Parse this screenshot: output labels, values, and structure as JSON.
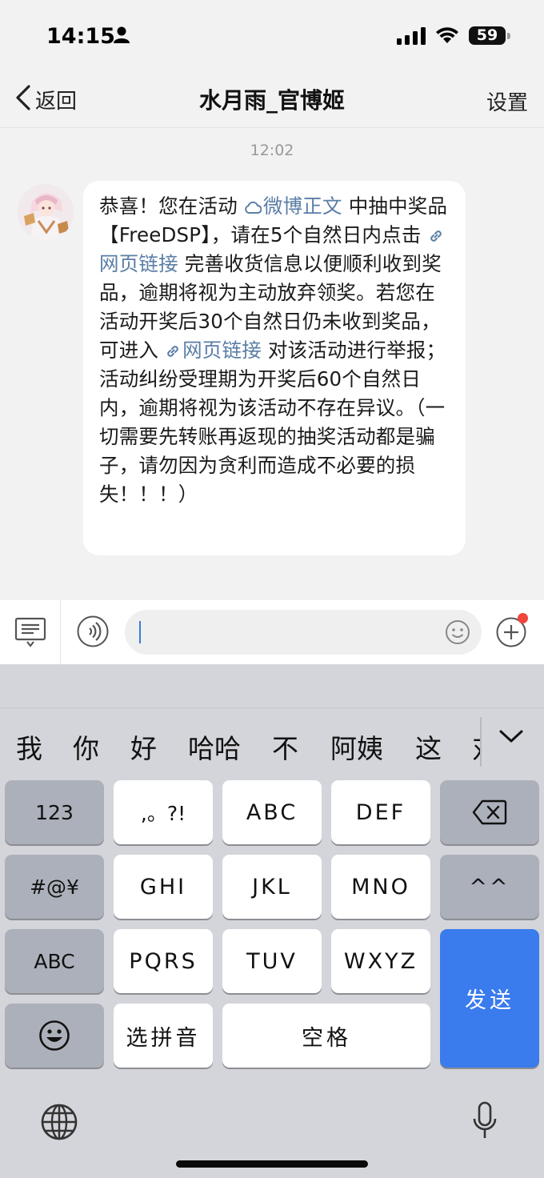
{
  "status_bar": {
    "time": "14:15",
    "battery": "59"
  },
  "nav": {
    "back_label": "返回",
    "title": "水月雨_官博姬",
    "settings_label": "设置"
  },
  "chat": {
    "timestamp": "12:02",
    "message": {
      "seg1": "恭喜！您在活动 ",
      "link1": "微博正文",
      "seg2": " 中抽中奖品【FreeDSP】，请在5个自然日内点击 ",
      "link2": "网页链接",
      "seg3": " 完善收货信息以便顺利收到奖品，逾期将视为主动放弃领奖。若您在活动开奖后30个自然日仍未收到奖品，可进入 ",
      "link3": "网页链接",
      "seg4": " 对该活动进行举报；活动纠纷受理期为开奖后60个自然日内，逾期将视为该活动不存在异议。（一切需要先转账再返现的抽奖活动都是骗子，请勿因为贪利而造成不必要的损失！！！）"
    }
  },
  "keyboard": {
    "candidates": [
      "我",
      "你",
      "好",
      "哈哈",
      "不",
      "阿姨",
      "这",
      "对"
    ],
    "row1": [
      "123",
      ",。?!",
      "ABC",
      "DEF"
    ],
    "row2": [
      "#@¥",
      "GHI",
      "JKL",
      "MNO",
      "^^"
    ],
    "row3": [
      "ABC",
      "PQRS",
      "TUV",
      "WXYZ"
    ],
    "row4": [
      "选拼音",
      "空格"
    ],
    "send_label": "发送"
  },
  "colors": {
    "link": "#5a7ea6",
    "send_key": "#3a7bed",
    "notification_dot": "#f0463c"
  }
}
